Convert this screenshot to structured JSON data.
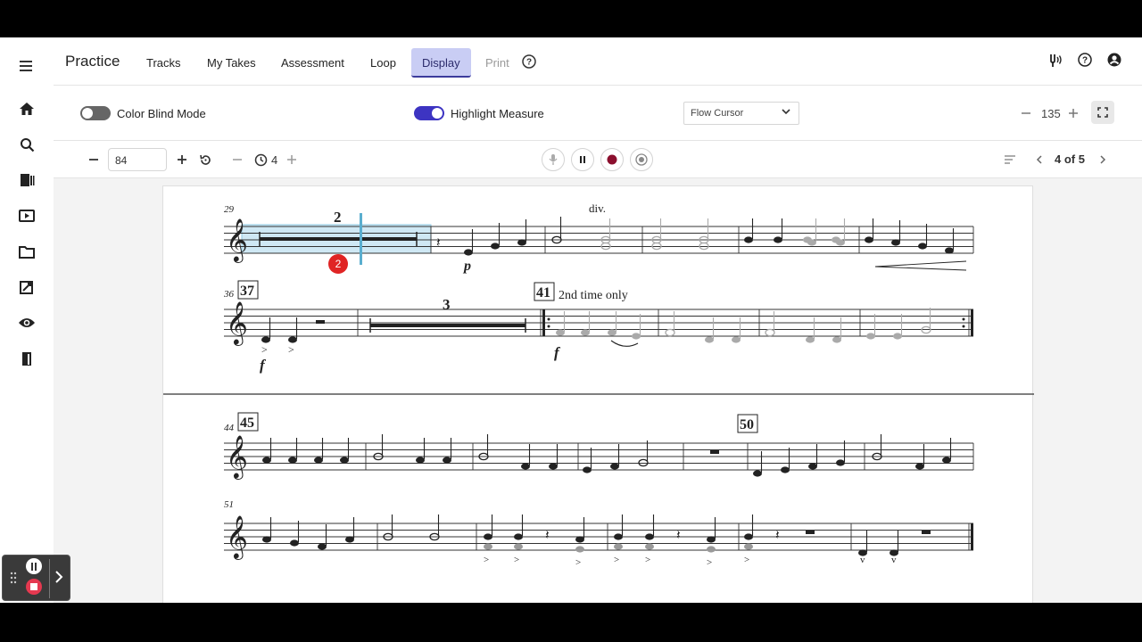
{
  "nav": {
    "brand": "Practice",
    "tabs": [
      "Tracks",
      "My Takes",
      "Assessment",
      "Loop",
      "Display",
      "Print"
    ],
    "active_tab": "Display"
  },
  "options": {
    "color_blind_label": "Color Blind Mode",
    "color_blind_on": false,
    "highlight_label": "Highlight Measure",
    "highlight_on": true,
    "cursor_select_value": "Flow Cursor",
    "zoom_value": "135"
  },
  "transport": {
    "tempo_value": "84",
    "countin_value": "4",
    "page_indicator": "4 of 5"
  },
  "score": {
    "measure_numbers": [
      "29",
      "36",
      "44",
      "51"
    ],
    "rehearsal_marks": [
      "37",
      "41",
      "45",
      "50"
    ],
    "multirest_counts": [
      "2",
      "3"
    ],
    "performance_text": [
      "div.",
      "2nd time only"
    ],
    "dynamics": [
      "p",
      "f",
      "f"
    ],
    "cursor_badge": "2"
  },
  "colors": {
    "accent": "#3d34c2",
    "active_tab_bg": "#c9cdf4",
    "highlight": "#cfe8f4",
    "record": "#8b0f2e"
  }
}
